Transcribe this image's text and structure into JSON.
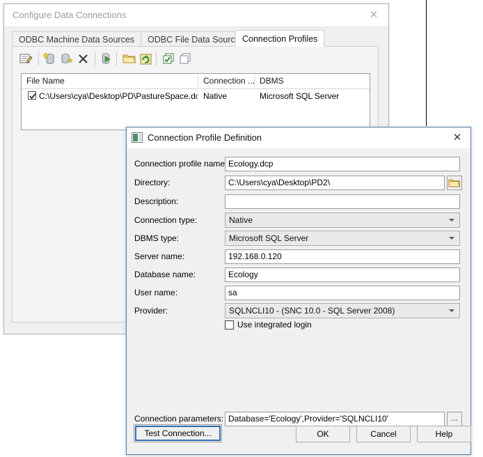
{
  "background_window": {
    "title": "Configure Data Connections",
    "close_icon": "close-icon",
    "tabs": [
      {
        "label": "ODBC Machine Data Sources",
        "active": false
      },
      {
        "label": "ODBC File Data Sources",
        "active": false
      },
      {
        "label": "Connection Profiles",
        "active": true
      }
    ],
    "toolbar": {
      "items": [
        {
          "name": "edit-profile-icon",
          "tooltip": "Edit"
        },
        {
          "name": "new-data-source-icon",
          "tooltip": "New data source"
        },
        {
          "name": "add-data-source-icon",
          "tooltip": "Add data source"
        },
        {
          "name": "delete-icon",
          "tooltip": "Delete"
        },
        {
          "name": "test-connection-icon",
          "tooltip": "Test connection"
        },
        {
          "name": "open-folder-icon",
          "tooltip": "Open"
        },
        {
          "name": "refresh-icon",
          "tooltip": "Refresh"
        },
        {
          "name": "select-all-icon",
          "tooltip": "Select all"
        },
        {
          "name": "deselect-all-icon",
          "tooltip": "Deselect all"
        }
      ]
    },
    "list": {
      "columns": [
        "File Name",
        "Connection ...",
        "DBMS"
      ],
      "rows": [
        {
          "checked": true,
          "file_name": "C:\\Users\\cya\\Desktop\\PD\\PastureSpace.dcp",
          "connection": "Native",
          "dbms": "Microsoft SQL Server"
        }
      ]
    }
  },
  "dialog": {
    "title": "Connection Profile Definition",
    "title_icon": "window-icon",
    "close_icon": "close-icon",
    "fields": {
      "profile_name": {
        "label": "Connection profile name:",
        "value": "Ecology.dcp"
      },
      "directory": {
        "label": "Directory:",
        "value": "C:\\Users\\cya\\Desktop\\PD2\\",
        "browse_icon": "folder-icon"
      },
      "description": {
        "label": "Description:",
        "value": ""
      },
      "connection_type": {
        "label": "Connection type:",
        "value": "Native"
      },
      "dbms_type": {
        "label": "DBMS type:",
        "value": "Microsoft SQL Server"
      },
      "server_name": {
        "label": "Server name:",
        "value": "192.168.0.120"
      },
      "database_name": {
        "label": "Database name:",
        "value": "Ecology"
      },
      "user_name": {
        "label": "User name:",
        "value": "sa"
      },
      "provider": {
        "label": "Provider:",
        "value": "SQLNCLI10 - (SNC 10.0 - SQL Server 2008)"
      },
      "integrated_login": {
        "label": "Use integrated login",
        "checked": false
      },
      "connection_parameters": {
        "label": "Connection parameters:",
        "value": "Database='Ecology',Provider='SQLNCLI10'",
        "more_button_label": "..."
      }
    },
    "buttons": {
      "test": "Test Connection...",
      "ok": "OK",
      "cancel": "Cancel",
      "help": "Help"
    }
  },
  "colors": {
    "focus_border": "#2f6db5",
    "dialog_border": "#4f7ca8",
    "window_face": "#f0f0f0",
    "disabled_combo": "#e9e9e9"
  }
}
